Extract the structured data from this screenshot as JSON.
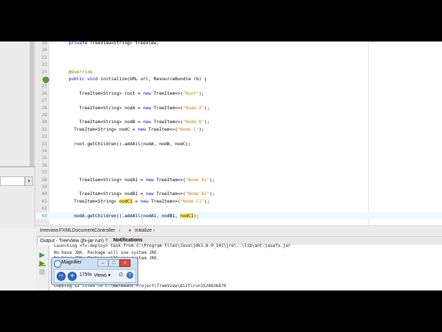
{
  "editor": {
    "lines": [
      {
        "n": "19",
        "text": "    private TreeView<String> treeView;"
      },
      {
        "n": "20",
        "text": ""
      },
      {
        "n": "21",
        "text": ""
      },
      {
        "n": "22",
        "text": ""
      },
      {
        "n": "23",
        "text": "    @Override"
      },
      {
        "n": "24",
        "text": "    public void initialize(URL url, ResourceBundle rb) {"
      },
      {
        "n": "25",
        "text": ""
      },
      {
        "n": "26",
        "text": "        TreeItem<String> root = new TreeItem<>(\"Root\");"
      },
      {
        "n": "27",
        "text": ""
      },
      {
        "n": "28",
        "text": "        TreeItem<String> nodA = new TreeItem<>(\"Node A\");"
      },
      {
        "n": "29",
        "text": ""
      },
      {
        "n": "30",
        "text": "        TreeItem<String> nodB = new TreeItem<>(\"Node B\");"
      },
      {
        "n": "31",
        "text": "      TreeItem<String> nodC = new TreeItem<>(\"Node C\");"
      },
      {
        "n": "32",
        "text": ""
      },
      {
        "n": "33",
        "text": "      root.getChildren().addAll(nodA, nodB, nodC);"
      },
      {
        "n": "34",
        "text": ""
      },
      {
        "n": "35",
        "text": ""
      },
      {
        "n": "36",
        "text": ""
      },
      {
        "n": "37",
        "text": ""
      },
      {
        "n": "38",
        "text": "        TreeItem<String> nodA1 = new TreeItem<>(\"Node A1\");"
      },
      {
        "n": "39",
        "text": ""
      },
      {
        "n": "40",
        "text": "        TreeItem<String> nodB1 = new TreeItem<>(\"Node B1\");"
      },
      {
        "n": "41",
        "text": "      TreeItem<String> nodC1 = new TreeItem<>(\"Node C1\");"
      },
      {
        "n": "42",
        "text": ""
      },
      {
        "n": "43",
        "text": "      nodA.getChildren().addAll(nodA1, nodB1, nodC1);"
      }
    ]
  },
  "breadcrumb": {
    "class_label": "treeview.FXMLDocumentController",
    "method_label": "initialize"
  },
  "output": {
    "tab_output": "Output - TreeView (jfx-jar run)",
    "tab_notifications": "Notifications",
    "lines": [
      "Launching <fx:deploy> task from C:\\Program Files\\Java\\jdk1.8.0_101\\jre\\..\\lib\\ant-javafx.jar",
      "No base JDK. Package will use system JRE.",
      "No base JDK. Package will use system JRE.",
      "",
      "Copying 12 files to C:\\NetBeans Project\\TreeView\\dist\\run1528836870"
    ]
  },
  "magnifier": {
    "title": "Magnifier",
    "zoom": "175%",
    "views": "Views"
  },
  "colors": {
    "keyword": "#0000e6",
    "string": "#ce7b00",
    "annotation": "#7d7d00",
    "highlight": "#fff26a"
  }
}
